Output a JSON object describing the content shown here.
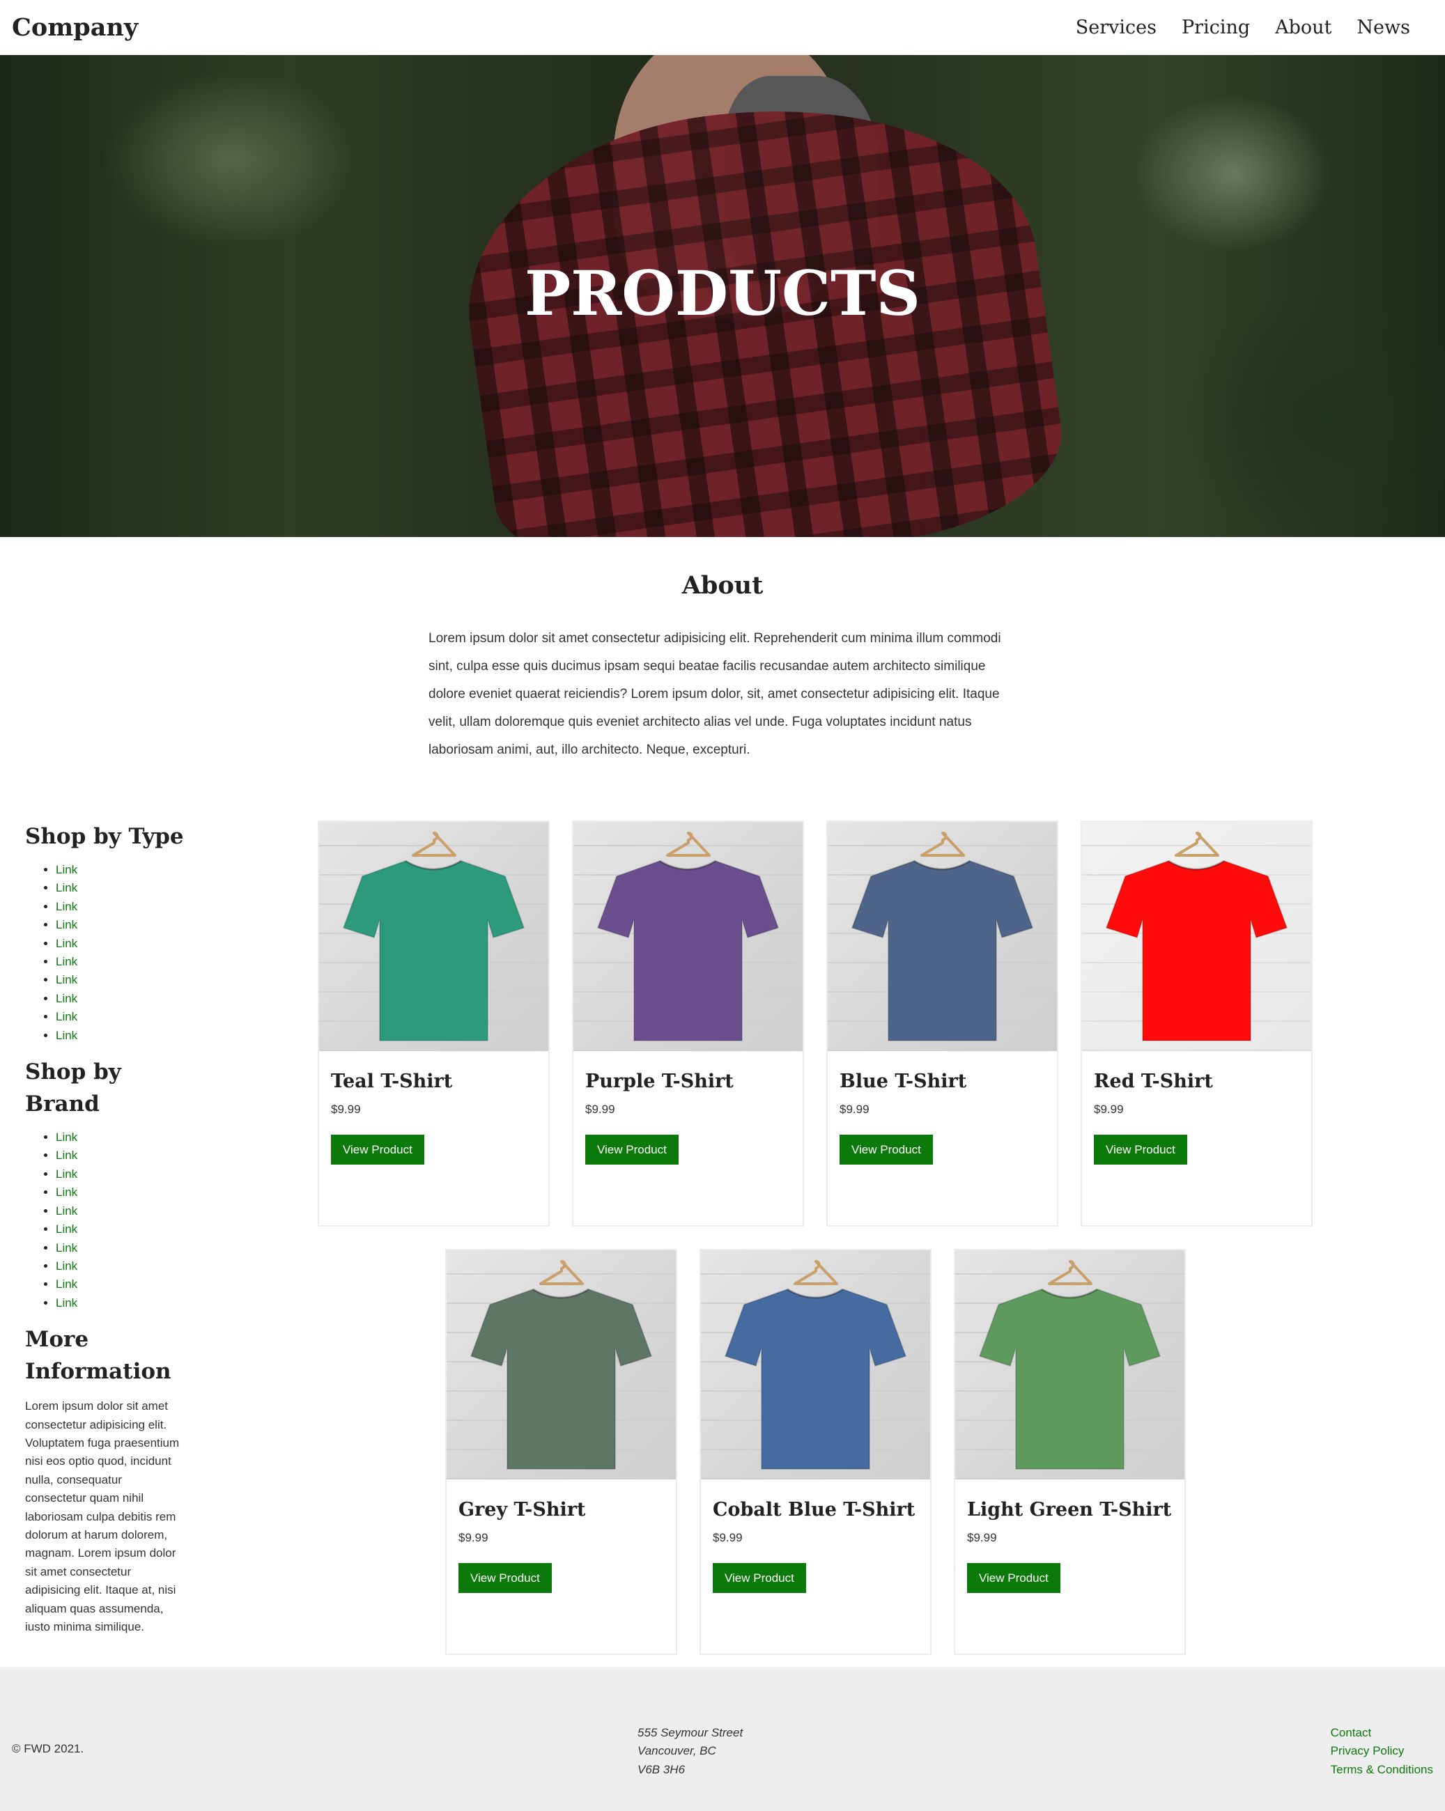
{
  "header": {
    "brand": "Company",
    "nav": [
      "Services",
      "Pricing",
      "About",
      "News"
    ]
  },
  "hero": {
    "title": "PRODUCTS"
  },
  "about": {
    "heading": "About",
    "text": "Lorem ipsum dolor sit amet consectetur adipisicing elit. Reprehenderit cum minima illum commodi sint, culpa esse quis ducimus ipsam sequi beatae facilis recusandae autem architecto similique dolore eveniet quaerat reiciendis? Lorem ipsum dolor, sit, amet consectetur adipisicing elit. Itaque velit, ullam doloremque quis eveniet architecto alias vel unde. Fuga voluptates incidunt natus laboriosam animi, aut, illo architecto. Neque, excepturi."
  },
  "sidebar": {
    "type_heading": "Shop by Type",
    "type_links": [
      "Link",
      "Link",
      "Link",
      "Link",
      "Link",
      "Link",
      "Link",
      "Link",
      "Link",
      "Link"
    ],
    "brand_heading": "Shop by Brand",
    "brand_links": [
      "Link",
      "Link",
      "Link",
      "Link",
      "Link",
      "Link",
      "Link",
      "Link",
      "Link",
      "Link"
    ],
    "info_heading": "More Information",
    "info_text": "Lorem ipsum dolor sit amet consectetur adipisicing elit. Voluptatem fuga praesentium nisi eos optio quod, incidunt nulla, consequatur consectetur quam nihil laboriosam culpa debitis rem dolorum at harum dolorem, magnam. Lorem ipsum dolor sit amet consectetur adipisicing elit. Itaque at, nisi aliquam quas assumenda, iusto minima similique."
  },
  "products": [
    {
      "title": "Teal T-Shirt",
      "price": "$9.99",
      "button": "View Product",
      "color": "#2e9a7c"
    },
    {
      "title": "Purple T-Shirt",
      "price": "$9.99",
      "button": "View Product",
      "color": "#6a4e8e"
    },
    {
      "title": "Blue T-Shirt",
      "price": "$9.99",
      "button": "View Product",
      "color": "#4e6488"
    },
    {
      "title": "Red T-Shirt",
      "price": "$9.99",
      "button": "View Product",
      "color": "#ff0b0b"
    },
    {
      "title": "Grey T-Shirt",
      "price": "$9.99",
      "button": "View Product",
      "color": "#5f7565"
    },
    {
      "title": "Cobalt Blue T-Shirt",
      "price": "$9.99",
      "button": "View Product",
      "color": "#456ba0"
    },
    {
      "title": "Light Green T-Shirt",
      "price": "$9.99",
      "button": "View Product",
      "color": "#5e9a5e"
    }
  ],
  "footer": {
    "copyright": "© FWD 2021.",
    "address": [
      "555 Seymour Street",
      "Vancouver, BC",
      "V6B 3H6"
    ],
    "links": [
      "Contact",
      "Privacy Policy",
      "Terms & Conditions"
    ]
  },
  "colors": {
    "accent": "#0b7a0b",
    "footer_bg": "#eeeeee"
  }
}
